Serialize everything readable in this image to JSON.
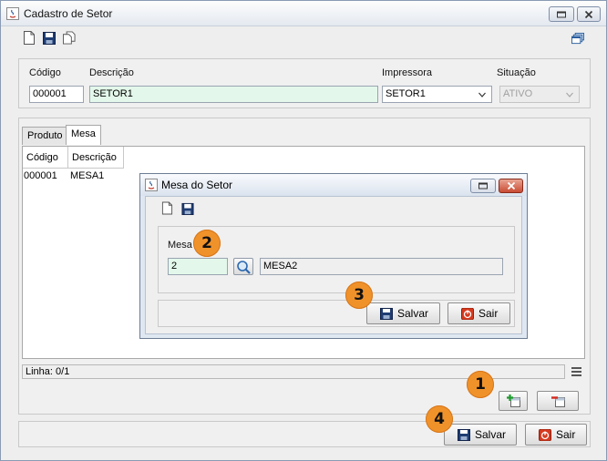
{
  "window": {
    "title": "Cadastro de Setor"
  },
  "form": {
    "codigo_label": "Código",
    "codigo_value": "000001",
    "descricao_label": "Descrição",
    "descricao_value": "SETOR1",
    "impressora_label": "Impressora",
    "impressora_value": "SETOR1",
    "situacao_label": "Situação",
    "situacao_value": "ATIVO"
  },
  "tabs": [
    {
      "label": "Produto"
    },
    {
      "label": "Mesa"
    }
  ],
  "grid": {
    "columns": [
      "Código",
      "Descrição"
    ],
    "rows": [
      {
        "codigo": "000001",
        "descricao": "MESA1"
      }
    ]
  },
  "status": {
    "text": "Linha: 0/1"
  },
  "buttons": {
    "salvar": "Salvar",
    "sair": "Sair"
  },
  "dialog": {
    "title": "Mesa do Setor",
    "mesa_label": "Mesa",
    "mesa_code": "2",
    "mesa_desc": "MESA2",
    "salvar": "Salvar",
    "sair": "Sair"
  },
  "annotations": [
    "1",
    "2",
    "3",
    "4"
  ],
  "colors": {
    "badge": "#f0922a",
    "field_highlight": "#e3f8ea",
    "sair_icon": "#d63a1f"
  }
}
